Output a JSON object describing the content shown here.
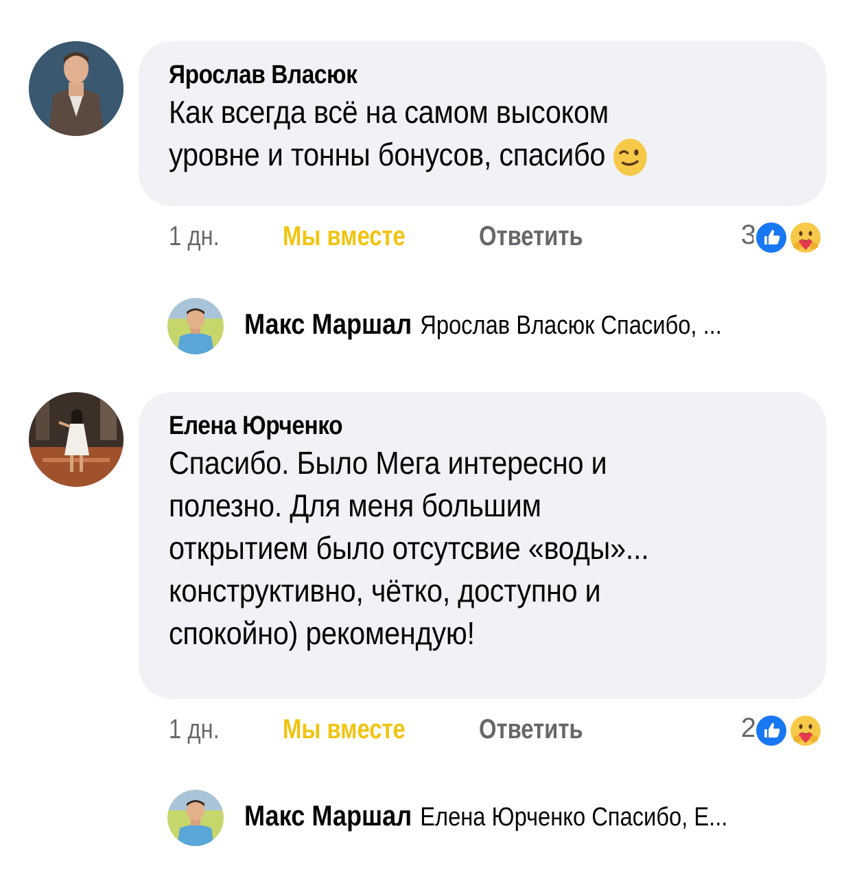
{
  "comments": [
    {
      "author": "Ярослав Власюк",
      "text": "Как всегда всё на самом высоком\nуровне и тонны бонусов, спасибо",
      "time": "1 дн.",
      "together_label": "Мы вместе",
      "reply_label": "Ответить",
      "reaction_count": "3",
      "reply_preview": {
        "author": "Макс Маршал",
        "text": "Ярослав Власюк Спасибо, ..."
      }
    },
    {
      "author": "Елена Юрченко",
      "text": "Спасибо. Было Мега интересно и\nполезно. Для меня большим\nоткрытием было отсутсвие «воды»...\nконструктивно, чётко, доступно и\nспокойно) рекомендую!",
      "time": "1 дн.",
      "together_label": "Мы вместе",
      "reply_label": "Ответить",
      "reaction_count": "2",
      "reply_preview": {
        "author": "Макс Маршал",
        "text": "Елена Юрченко Спасибо, Е..."
      }
    }
  ],
  "colors": {
    "bubble": "#f0f2f5",
    "secondary_text": "#65676b",
    "together_accent": "#f1c40f",
    "like_blue": "#1877f2"
  },
  "icons": [
    "wink-emoji-icon",
    "like-reaction-icon",
    "care-reaction-icon"
  ]
}
